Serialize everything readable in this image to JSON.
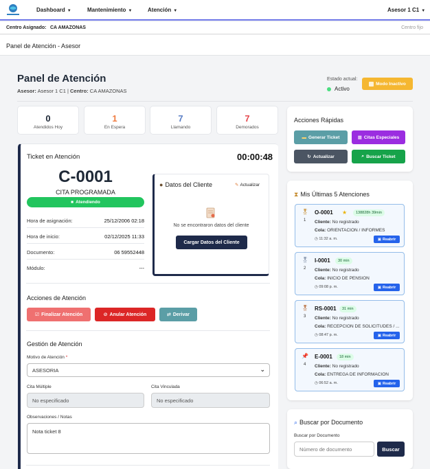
{
  "navbar": {
    "menu": [
      {
        "label": "Dashboard"
      },
      {
        "label": "Mantenimiento"
      },
      {
        "label": "Atención"
      }
    ],
    "user": "Asesor 1 C1"
  },
  "centro": {
    "label": "Centro Asignado:",
    "value": "CA AMAZONAS",
    "fijo": "Centro fijo"
  },
  "page_header": "Panel de Atención - Asesor",
  "header": {
    "title": "Panel de Atención",
    "asesor_label": "Asesor:",
    "asesor_value": "Asesor 1 C1",
    "centro_label": "Centro:",
    "centro_value": "CA AMAZONAS",
    "estado_label": "Estado actual:",
    "estado_value": "Activo",
    "modo_button": "Modo Inactivo"
  },
  "stats": [
    {
      "value": "0",
      "label": "Atendidos Hoy",
      "color": "#1f2937"
    },
    {
      "value": "1",
      "label": "En Espera",
      "color": "#f07b3f"
    },
    {
      "value": "7",
      "label": "Llamando",
      "color": "#5b7fc6"
    },
    {
      "value": "7",
      "label": "Demorados",
      "color": "#e5484d"
    }
  ],
  "ticket": {
    "title": "Ticket en Atención",
    "timer": "00:00:48",
    "code": "C-0001",
    "type": "CITA PROGRAMADA",
    "status": "Atendiendo",
    "rows": [
      {
        "label": "Hora de asignación:",
        "value": "25/12/2006 02:18"
      },
      {
        "label": "Hora de inicio:",
        "value": "02/12/2025 11:33"
      },
      {
        "label": "Documento:",
        "value": "06 59552448"
      },
      {
        "label": "Módulo:",
        "value": "---"
      }
    ]
  },
  "cliente": {
    "title": "Datos del Cliente",
    "actualizar": "Actualizar",
    "empty_msg": "No se encontraron datos del cliente",
    "load_button": "Cargar Datos del Cliente"
  },
  "acciones": {
    "title": "Acciones de Atención",
    "buttons": [
      {
        "label": "Finalizar Atención",
        "color": "#ef7070"
      },
      {
        "label": "Anular Atención",
        "color": "#dc2626"
      },
      {
        "label": "Derivar",
        "color": "#5b9ea6"
      }
    ]
  },
  "gestion": {
    "title": "Gestión de Atención",
    "motivo_label": "Motivo de Atención",
    "required_mark": "*",
    "motivo_value": "ASESORIA",
    "cita_multiple_label": "Cita Múltiple",
    "cita_multiple_value": "No especificado",
    "cita_vinculada_label": "Cita Vinculada",
    "cita_vinculada_value": "No especificado",
    "obs_label": "Observaciones / Notas",
    "obs_value": "Nota ticket 8"
  },
  "quick": {
    "title": "Acciones Rápidas",
    "buttons": [
      {
        "label": "Generar Ticket",
        "color": "#5b9ea6"
      },
      {
        "label": "Citas Especiales",
        "color": "#9b2de0"
      },
      {
        "label": "Actualizar",
        "color": "#4b5563"
      },
      {
        "label": "Buscar Ticket",
        "color": "#16a34a"
      }
    ]
  },
  "ultimas": {
    "title": "Mis Últimas 5 Atenciones",
    "cliente_label": "Cliente:",
    "cola_label": "Cola:",
    "reabrir": "Reabrir",
    "items": [
      {
        "num": "1",
        "code": "O-0001",
        "time": "138828h 39min",
        "star": true,
        "cliente": "No registrado",
        "cola": "ORIENTACION / INFORMES",
        "hora": "11:32 a. m."
      },
      {
        "num": "2",
        "code": "I-0001",
        "time": "30 min",
        "star": false,
        "cliente": "No registrado",
        "cola": "INICIO DE PENSION",
        "hora": "09:08 p. m."
      },
      {
        "num": "3",
        "code": "RS-0001",
        "time": "31 min",
        "star": false,
        "cliente": "No registrado",
        "cola": "RECEPCION DE SOLICITUDES / ...",
        "hora": "08:47 p. m."
      },
      {
        "num": "4",
        "code": "E-0001",
        "time": "18 min",
        "star": false,
        "cliente": "No registrado",
        "cola": "ENTREGA DE INFORMACION",
        "hora": "06:52 a. m."
      }
    ]
  },
  "buscar": {
    "title": "Buscar por Documento",
    "label": "Buscar por Documento",
    "placeholder": "Número de documento",
    "button": "Buscar"
  }
}
